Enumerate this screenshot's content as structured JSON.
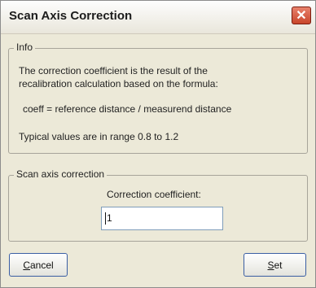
{
  "window": {
    "title": "Scan Axis Correction",
    "close_glyph": "✕"
  },
  "info": {
    "legend": "Info",
    "line1": "The correction coefficient is the result of the",
    "line2": "recalibration calculation based on the formula:",
    "formula": "coeff = reference distance / measurend distance",
    "range": "Typical values are in range 0.8 to 1.2"
  },
  "correction": {
    "legend": "Scan axis correction",
    "label": "Correction coefficient:",
    "value": "1"
  },
  "buttons": {
    "cancel": "Cancel",
    "set": "Set"
  },
  "colors": {
    "window_bg": "#ece9d8",
    "close_red": "#c9452b",
    "border": "#a7a49a"
  }
}
